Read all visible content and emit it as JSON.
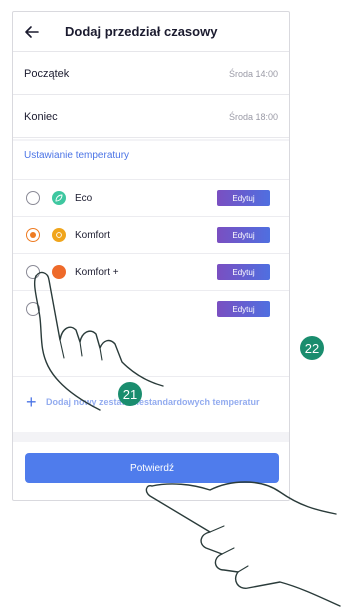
{
  "header": {
    "title": "Dodaj przedział czasowy",
    "back_icon": "arrow-left-icon"
  },
  "time_rows": [
    {
      "label": "Początek",
      "value": "Środa 14:00"
    },
    {
      "label": "Koniec",
      "value": "Środa 18:00"
    }
  ],
  "temperature_section": {
    "title": "Ustawianie temperatury",
    "options": [
      {
        "name": "Eco",
        "selected": false,
        "icon": "leaf-icon",
        "icon_color": "#3ec7a0",
        "edit_label": "Edytuj"
      },
      {
        "name": "Komfort",
        "selected": true,
        "icon": "sun-icon",
        "icon_color": "#f0a51c",
        "edit_label": "Edytuj"
      },
      {
        "name": "Komfort +",
        "selected": false,
        "icon": "sun-plus-icon",
        "icon_color": "#ee6a2a",
        "edit_label": "Edytuj"
      },
      {
        "name": "",
        "selected": false,
        "icon": "custom-icon",
        "icon_color": "#9a9aa6",
        "edit_label": "Edytuj"
      }
    ],
    "add_text": "Dodaj nowy zestaw niestandardowych temperatur"
  },
  "confirm_label": "Potwierdź",
  "badges": {
    "first": "21",
    "second": "22"
  },
  "colors": {
    "accent": "#4f7cec",
    "edit_gradient_start": "#7a4fc1",
    "edit_gradient_end": "#4f6fe0",
    "badge": "#1a8d6e",
    "selected_radio": "#ee7b22"
  }
}
